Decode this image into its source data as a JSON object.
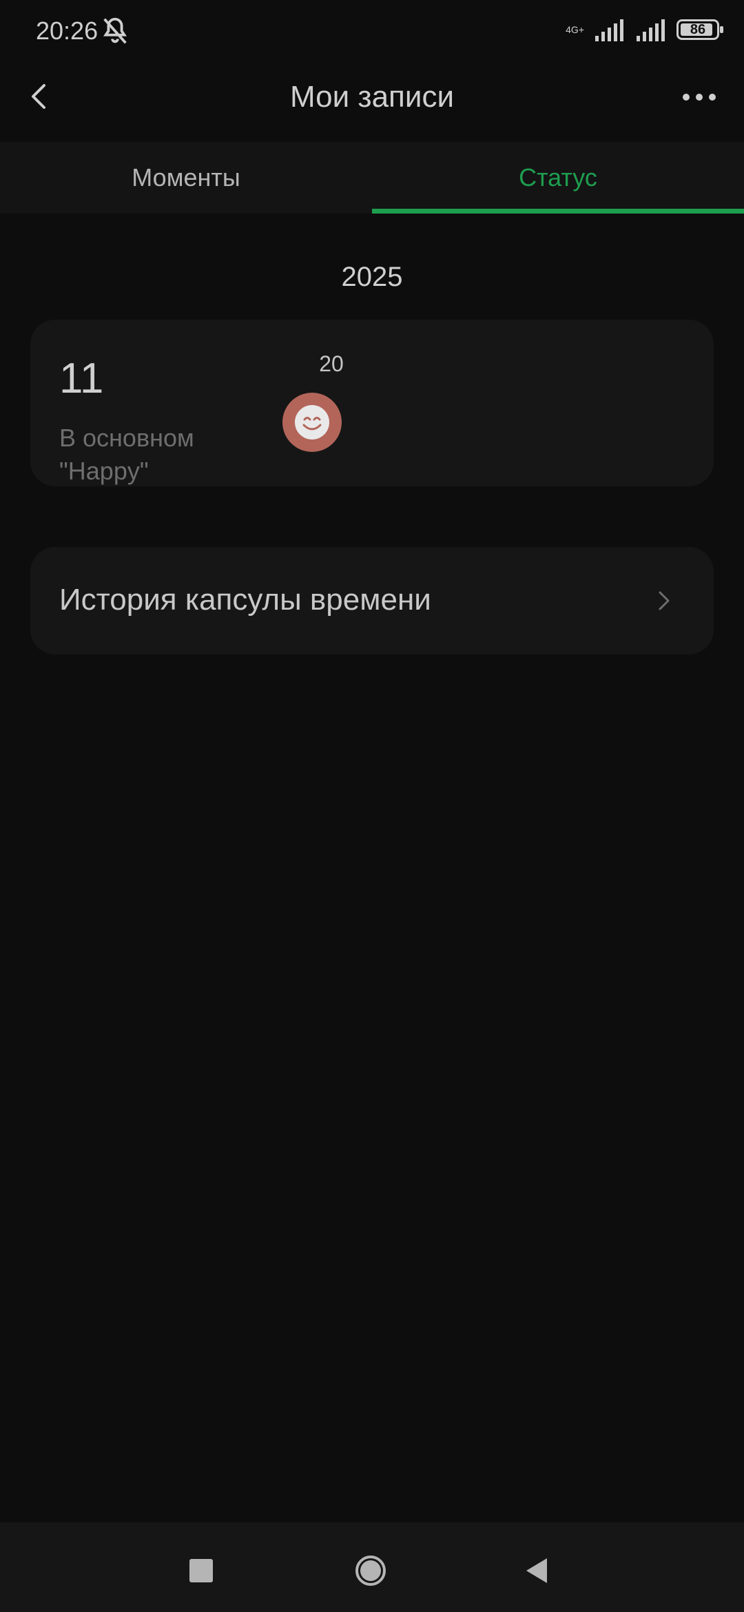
{
  "status_bar": {
    "time": "20:26",
    "network_label": "4G+",
    "battery": "86",
    "icons": [
      "bell-muted-icon",
      "signal-icon",
      "signal-icon",
      "battery-icon"
    ]
  },
  "header": {
    "title": "Мои записи",
    "icons": [
      "back-arrow-icon",
      "more-dots-icon"
    ]
  },
  "tabs": [
    {
      "label": "Моменты",
      "active": false
    },
    {
      "label": "Статус",
      "active": true
    }
  ],
  "year": "2025",
  "mood_summary": {
    "count": "11",
    "description": "В основном\n\"Happy\"",
    "day": "20",
    "mood_icon": "smile-face-icon",
    "mood_color": "#b3655a"
  },
  "history": {
    "label": "История капсулы времени",
    "icon": "chevron-right-icon"
  },
  "colors": {
    "accent": "#1e9e4f",
    "background": "#0d0d0d",
    "card": "#161616"
  },
  "navbar": {
    "icons": [
      "recents-square-icon",
      "home-circle-icon",
      "back-triangle-icon"
    ]
  }
}
